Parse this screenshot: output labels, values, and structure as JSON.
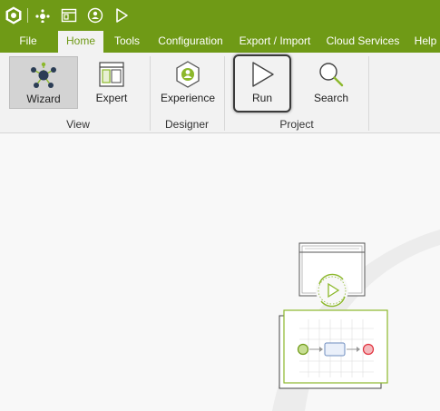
{
  "menu": {
    "items": [
      {
        "label": "File"
      },
      {
        "label": "Home"
      },
      {
        "label": "Tools"
      },
      {
        "label": "Configuration"
      },
      {
        "label": "Export / Import"
      },
      {
        "label": "Cloud Services"
      },
      {
        "label": "Help"
      }
    ],
    "active": "Home"
  },
  "ribbon": {
    "buttons": {
      "wizard": "Wizard",
      "expert": "Expert",
      "experience": "Experience",
      "run": "Run",
      "search": "Search"
    },
    "groups": {
      "view": "View",
      "designer": "Designer",
      "project": "Project"
    }
  },
  "quick_access_icons": [
    "app-logo-icon",
    "wizard-view-icon",
    "expert-view-icon",
    "experience-icon",
    "run-icon"
  ],
  "colors": {
    "brand_green": "#6f9a16",
    "accent_green": "#8cb82b",
    "end_red": "#e0303c",
    "ribbon_bg": "#f2f2f2"
  }
}
